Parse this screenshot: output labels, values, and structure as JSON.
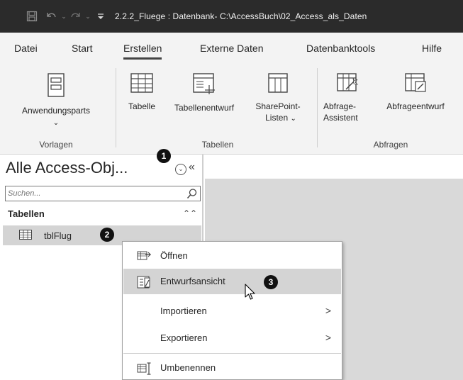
{
  "window": {
    "title": "2.2.2_Fluege : Datenbank- C:\\AccessBuch\\02_Access_als_Daten"
  },
  "quick_access": {
    "icons": [
      "save-icon",
      "undo-icon",
      "redo-icon",
      "customize-icon"
    ]
  },
  "ribbon_tabs": [
    {
      "label": "Datei"
    },
    {
      "label": "Start"
    },
    {
      "label": "Erstellen",
      "active": true
    },
    {
      "label": "Externe Daten"
    },
    {
      "label": "Datenbanktools"
    },
    {
      "label": "Hilfe"
    }
  ],
  "ribbon": {
    "groups": [
      {
        "label": "Vorlagen",
        "buttons": [
          {
            "label": "Anwendungsparts",
            "icon": "application-parts-icon",
            "has_dropdown": true
          }
        ]
      },
      {
        "label": "Tabellen",
        "buttons": [
          {
            "label": "Tabelle",
            "icon": "table-icon"
          },
          {
            "label": "Tabellenentwurf",
            "icon": "table-design-icon"
          },
          {
            "label_line1": "SharePoint-",
            "label_line2": "Listen",
            "icon": "sharepoint-lists-icon",
            "has_dropdown": true
          }
        ]
      },
      {
        "label": "Abfragen",
        "buttons": [
          {
            "label_line1": "Abfrage-",
            "label_line2": "Assistent",
            "icon": "query-wizard-icon"
          },
          {
            "label": "Abfrageentwurf",
            "icon": "query-design-icon"
          }
        ]
      }
    ]
  },
  "nav_pane": {
    "title": "Alle Access-Obj...",
    "search_placeholder": "Suchen...",
    "group_header": "Tabellen",
    "items": [
      {
        "label": "tblFlug",
        "icon": "table-icon",
        "selected": true
      }
    ]
  },
  "context_menu": {
    "items": [
      {
        "label": "Öffnen",
        "icon": "open-icon"
      },
      {
        "label": "Entwurfsansicht",
        "icon": "design-view-icon",
        "highlighted": true
      },
      {
        "label": "Importieren",
        "has_submenu": true
      },
      {
        "label": "Exportieren",
        "has_submenu": true
      },
      {
        "label": "Umbenennen",
        "icon": "rename-icon"
      }
    ],
    "submenu_arrow": ">"
  },
  "callouts": [
    "1",
    "2",
    "3"
  ],
  "colors": {
    "titlebar_bg": "#2b2b2b",
    "ribbon_bg": "#f3f3f3",
    "selection_bg": "#d4d4d4",
    "workspace_bg": "#d9d9d9",
    "badge_bg": "#111111"
  }
}
